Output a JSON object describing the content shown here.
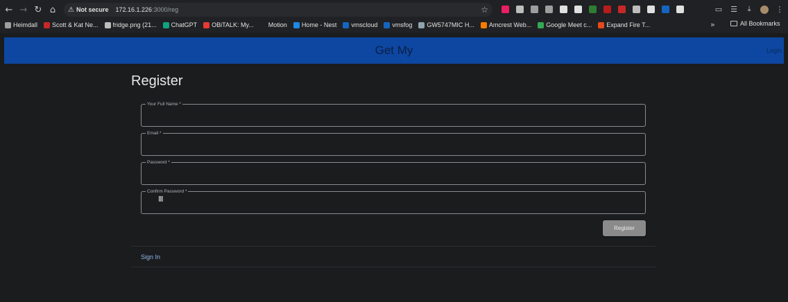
{
  "browser": {
    "url_security": "Not secure",
    "url_host": "172.16.1.226",
    "url_path": ":3000/reg",
    "bookmarks": [
      {
        "label": "Heimdall",
        "color": "#9e9e9e"
      },
      {
        "label": "Scott & Kat Ne...",
        "color": "#c62828"
      },
      {
        "label": "fridge.png (21...",
        "color": "#bdbdbd"
      },
      {
        "label": "ChatGPT",
        "color": "#10a37f"
      },
      {
        "label": "OBiTALK: My...",
        "color": "#e53935"
      },
      {
        "label": "Motion",
        "color": "#202124"
      },
      {
        "label": "Home - Nest",
        "color": "#1e88e5"
      },
      {
        "label": "vmscloud",
        "color": "#1565c0"
      },
      {
        "label": "vmsfog",
        "color": "#1565c0"
      },
      {
        "label": "GW5747MIC H...",
        "color": "#90a4ae"
      },
      {
        "label": "Amcrest Web...",
        "color": "#f57c00"
      },
      {
        "label": "Google Meet c...",
        "color": "#34a853"
      },
      {
        "label": "Expand Fire T...",
        "color": "#e64a19"
      }
    ],
    "all_bookmarks": "All Bookmarks",
    "extension_colors": [
      "#e91e63",
      "#bdbdbd",
      "#9e9e9e",
      "#9e9e9e",
      "#e0e0e0",
      "#e0e0e0",
      "#2e7d32",
      "#b71c1c",
      "#c62828",
      "#bdbdbd",
      "#e0e0e0",
      "#1565c0",
      "#e0e0e0"
    ]
  },
  "app": {
    "brand": "Get My",
    "login_link": "Login",
    "page_title": "Register",
    "fields": {
      "full_name": "Your Full Name *",
      "email": "Email *",
      "password": "Password *",
      "confirm_password": "Confirm Password *"
    },
    "register_button": "Register",
    "signin_link": "Sign In"
  }
}
